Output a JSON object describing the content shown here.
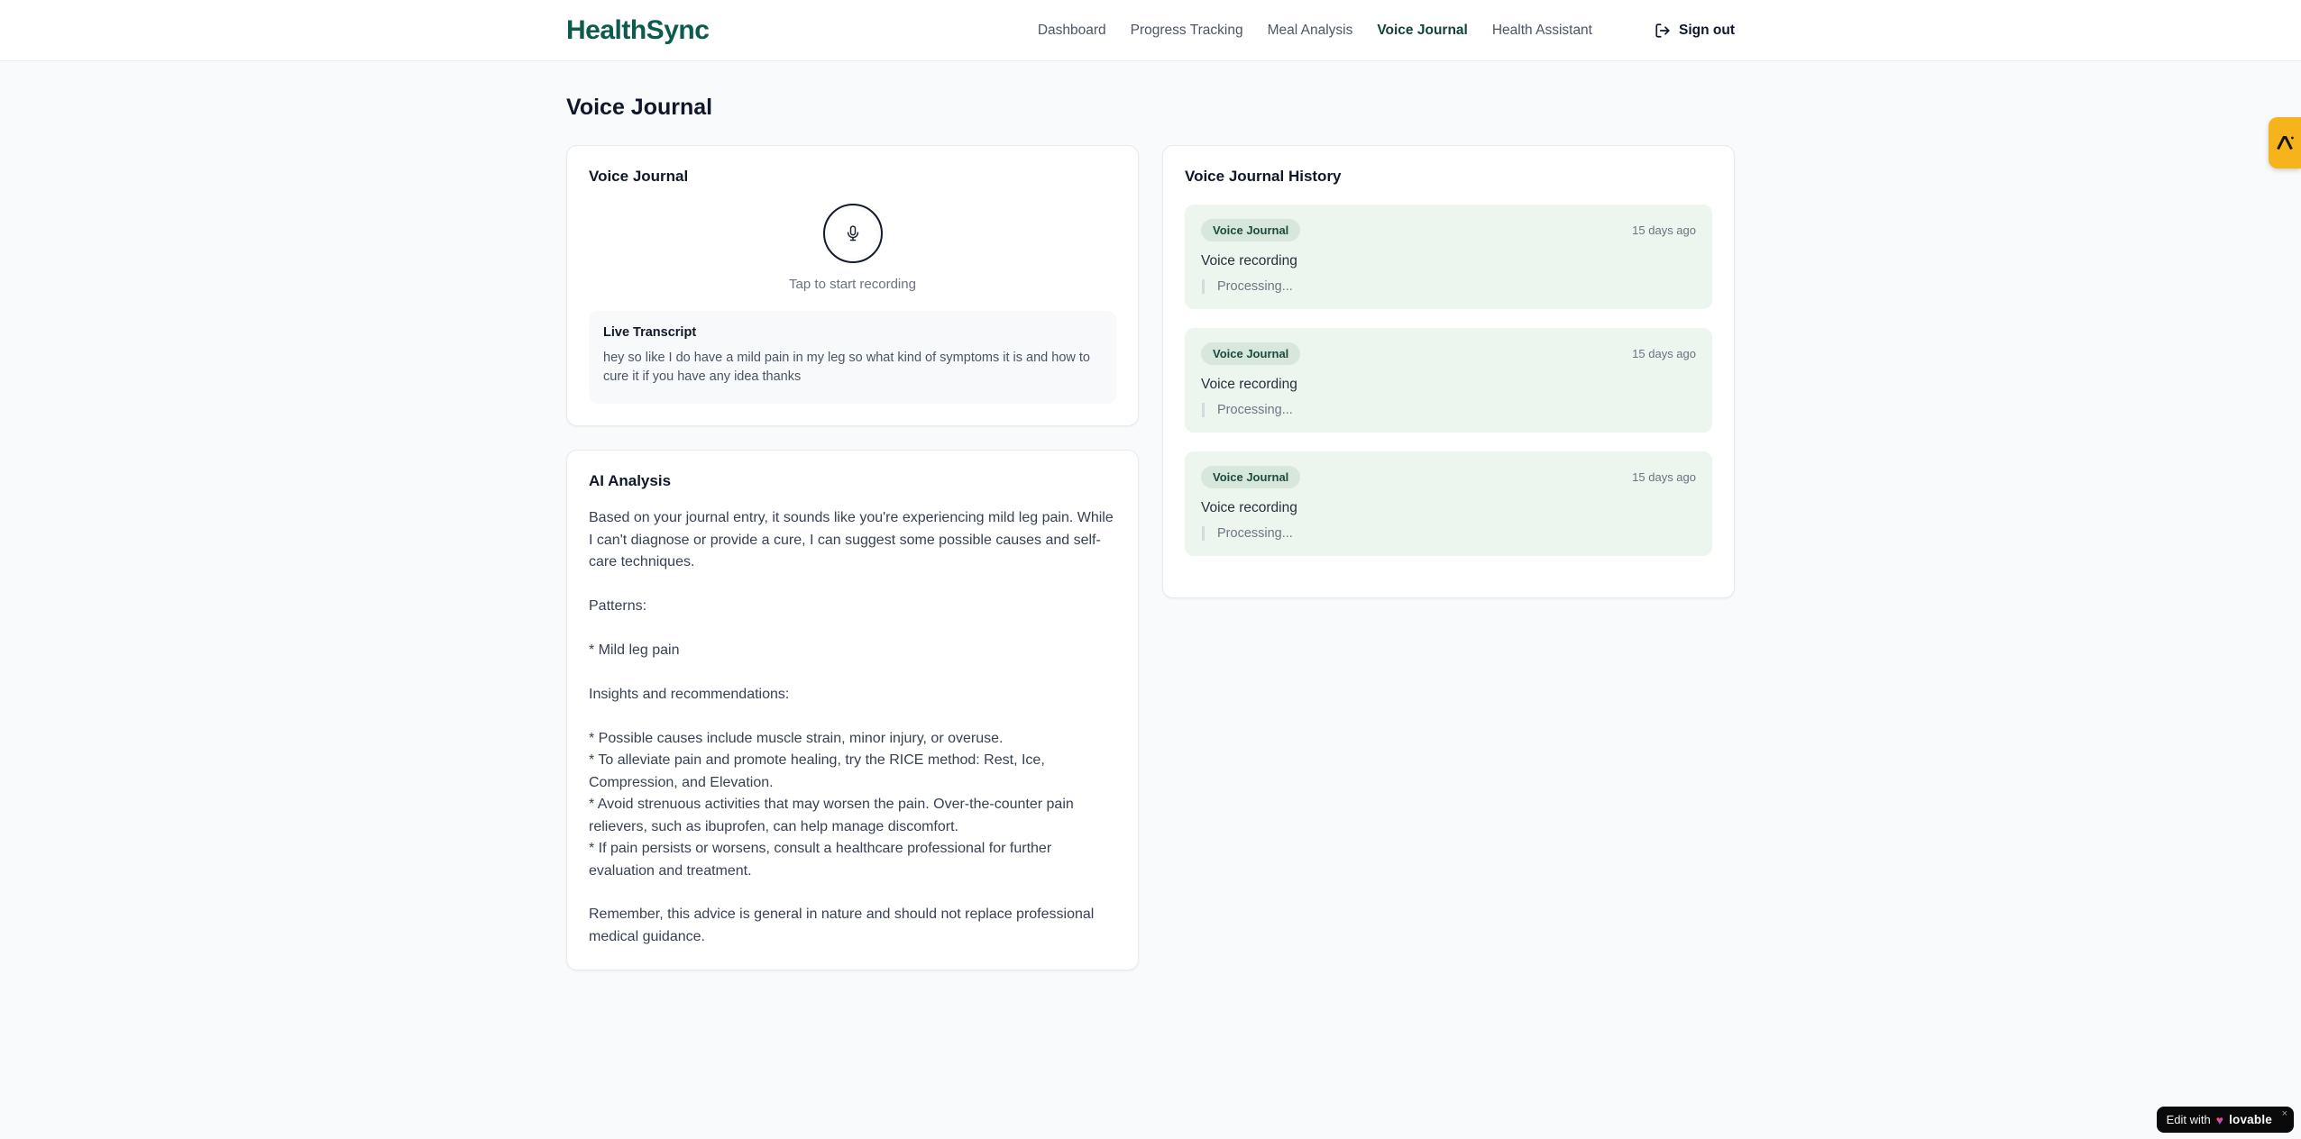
{
  "brand": {
    "name": "HealthSync"
  },
  "nav": {
    "items": [
      {
        "label": "Dashboard",
        "active": false
      },
      {
        "label": "Progress Tracking",
        "active": false
      },
      {
        "label": "Meal Analysis",
        "active": false
      },
      {
        "label": "Voice Journal",
        "active": true
      },
      {
        "label": "Health Assistant",
        "active": false
      }
    ],
    "sign_out_label": "Sign out"
  },
  "page": {
    "title": "Voice Journal"
  },
  "recorder_card": {
    "title": "Voice Journal",
    "tap_hint": "Tap to start recording",
    "live_transcript": {
      "title": "Live Transcript",
      "text": "hey so like I do have a mild pain in my leg so what kind of symptoms it is and how to cure it if you have any idea thanks"
    }
  },
  "analysis_card": {
    "title": "AI Analysis",
    "body": "Based on your journal entry, it sounds like you're experiencing mild leg pain. While I can't diagnose or provide a cure, I can suggest some possible causes and self-care techniques.\n\nPatterns:\n\n* Mild leg pain\n\nInsights and recommendations:\n\n* Possible causes include muscle strain, minor injury, or overuse.\n* To alleviate pain and promote healing, try the RICE method: Rest, Ice, Compression, and Elevation.\n* Avoid strenuous activities that may worsen the pain. Over-the-counter pain relievers, such as ibuprofen, can help manage discomfort.\n* If pain persists or worsens, consult a healthcare professional for further evaluation and treatment.\n\nRemember, this advice is general in nature and should not replace professional medical guidance."
  },
  "history_card": {
    "title": "Voice Journal History",
    "entries": [
      {
        "badge_label": "Voice Journal",
        "time": "15 days ago",
        "rec_title": "Voice recording",
        "status": "Processing..."
      },
      {
        "badge_label": "Voice Journal",
        "time": "15 days ago",
        "rec_title": "Voice recording",
        "status": "Processing..."
      },
      {
        "badge_label": "Voice Journal",
        "time": "15 days ago",
        "rec_title": "Voice recording",
        "status": "Processing..."
      }
    ]
  },
  "floating": {
    "lovable_badge": {
      "prefix": "Edit with",
      "brand": "lovable",
      "close": "×"
    }
  },
  "colors": {
    "brand_teal": "#0b5c4d",
    "nav_active": "#14413a",
    "history_entry_bg": "#edf5ef",
    "badge_bg": "#d8e7db",
    "badge_text": "#1d4a3f",
    "side_badge_amber": "#f6b31b",
    "page_bg": "#f8fafc"
  }
}
